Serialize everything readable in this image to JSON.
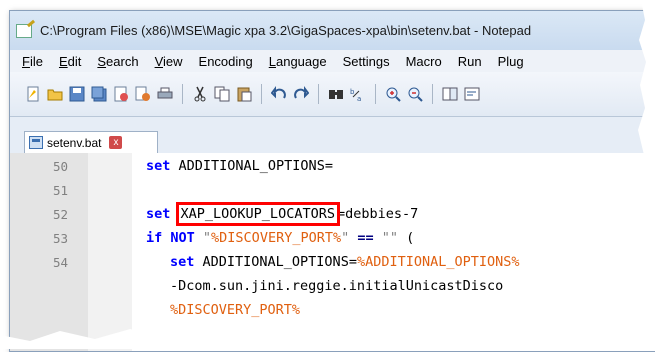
{
  "window": {
    "title": "C:\\Program Files (x86)\\MSE\\Magic xpa 3.2\\GigaSpaces-xpa\\bin\\setenv.bat - Notepad"
  },
  "menu": [
    {
      "label": "File",
      "u": "F",
      "rest": "ile"
    },
    {
      "label": "Edit",
      "u": "E",
      "rest": "dit"
    },
    {
      "label": "Search",
      "u": "S",
      "rest": "earch"
    },
    {
      "label": "View",
      "u": "V",
      "rest": "iew"
    },
    {
      "label": "Encoding",
      "u": "",
      "rest": "Encoding"
    },
    {
      "label": "Language",
      "u": "L",
      "rest": "anguage"
    },
    {
      "label": "Settings",
      "u": "",
      "rest": "Settings"
    },
    {
      "label": "Macro",
      "u": "",
      "rest": "Macro"
    },
    {
      "label": "Run",
      "u": "",
      "rest": "Run"
    },
    {
      "label": "Plugins",
      "u": "",
      "rest": "Plug"
    }
  ],
  "toolbar": {
    "icons": [
      "new-file-icon",
      "open-file-icon",
      "save-icon",
      "save-all-icon",
      "close-icon",
      "close-all-icon",
      "print-icon",
      "cut-icon",
      "copy-icon",
      "paste-icon",
      "undo-icon",
      "redo-icon",
      "find-icon",
      "replace-icon",
      "zoom-in-icon",
      "zoom-out-icon",
      "sync-icon",
      "wrap-icon"
    ]
  },
  "tab": {
    "label": "setenv.bat",
    "close": "x"
  },
  "lines": [
    {
      "num": "50",
      "kw": "set",
      "text": " ADDITIONAL_OPTIONS="
    },
    {
      "num": "51",
      "kw": "",
      "text": ""
    },
    {
      "num": "52",
      "kw": "set",
      "highlight": "XAP_LOOKUP_LOCATORS",
      "rest": "=debbies-7"
    },
    {
      "num": "53",
      "kw": "if",
      "text2a": " NOT ",
      "str1": "\"",
      "var1": "%DISCOVERY_PORT%",
      "str2": "\"",
      "op": " == ",
      "str3": "\"\"",
      "tail": " ("
    },
    {
      "num": "54",
      "kw": "set",
      "text": " ADDITIONAL_OPTIONS=",
      "var": "%ADDITIONAL_OPTIONS%"
    },
    {
      "num": "",
      "text": "-Dcom.sun.jini.reggie.initialUnicastDisco"
    },
    {
      "num": "",
      "var": "%DISCOVERY_PORT%"
    }
  ],
  "colors": {
    "keyword": "#0000ff",
    "variable": "#e06010",
    "highlight_box": "#ff0000"
  }
}
